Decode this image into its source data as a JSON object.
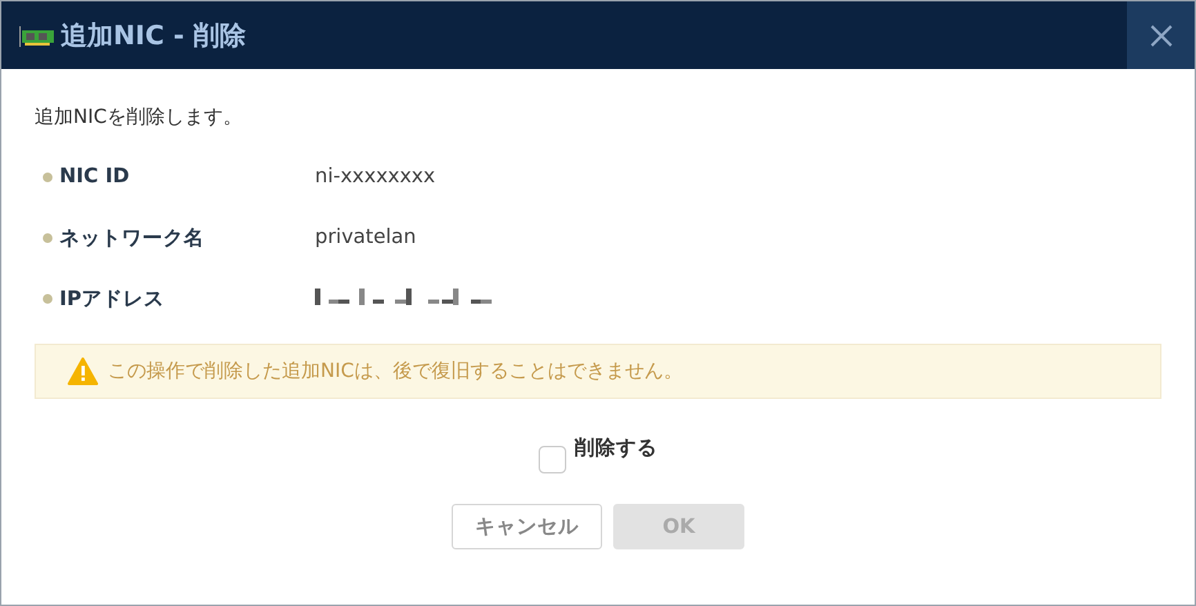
{
  "window": {
    "title": "追加NIC - 削除"
  },
  "message": "追加NICを削除します。",
  "details": [
    {
      "label": "NIC ID",
      "kind": "text",
      "value": "ni-xxxxxxxx"
    },
    {
      "label": "ネットワーク名",
      "kind": "text",
      "value": "privatelan"
    },
    {
      "label": "IPアドレス",
      "kind": "masked"
    }
  ],
  "warning": "この操作で削除した追加NICは、後で復旧することはできません。",
  "confirm": {
    "label": "削除する",
    "checked": false
  },
  "buttons": [
    {
      "label": "キャンセル",
      "disabled": false
    },
    {
      "label": "OK",
      "disabled": true
    }
  ]
}
